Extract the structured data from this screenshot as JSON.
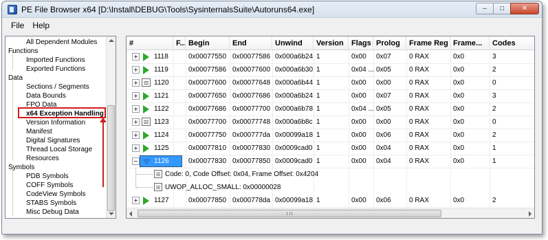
{
  "window": {
    "title": "PE File Browser x64 [D:\\Install\\DEBUG\\Tools\\SysinternalsSuite\\Autoruns64.exe]",
    "min_glyph": "–",
    "max_glyph": "□",
    "close_glyph": "✕"
  },
  "menu": [
    {
      "label": "File"
    },
    {
      "label": "Help"
    }
  ],
  "tree": {
    "items": [
      {
        "label": "All Dependent Modules",
        "level": 1
      },
      {
        "label": "Functions",
        "level": 0
      },
      {
        "label": "Imported Functions",
        "level": 1
      },
      {
        "label": "Exported Functions",
        "level": 1
      },
      {
        "label": "Data",
        "level": 0
      },
      {
        "label": "Sections / Segments",
        "level": 1
      },
      {
        "label": "Data Bounds",
        "level": 1
      },
      {
        "label": "FPO Data",
        "level": 1
      },
      {
        "label": "x64 Exception Handling",
        "level": 1,
        "selected": true
      },
      {
        "label": "Version Information",
        "level": 1
      },
      {
        "label": "Manifest",
        "level": 1
      },
      {
        "label": "Digital Signatures",
        "level": 1
      },
      {
        "label": "Thread Local Storage",
        "level": 1
      },
      {
        "label": "Resources",
        "level": 1
      },
      {
        "label": "Symbols",
        "level": 0
      },
      {
        "label": "PDB Symbols",
        "level": 1
      },
      {
        "label": "COFF Symbols",
        "level": 1
      },
      {
        "label": "CodeView Symbols",
        "level": 1
      },
      {
        "label": "STABS Symbols",
        "level": 1
      },
      {
        "label": "Misc Debug Data",
        "level": 1
      }
    ],
    "highlight_color": "#d11a1a"
  },
  "grid": {
    "columns": [
      "#",
      "F...",
      "Begin",
      "End",
      "Unwind",
      "Version",
      "Flags",
      "Prolog",
      "Frame Reg",
      "Frame...",
      "Codes"
    ],
    "rows": [
      {
        "id": "1118",
        "icon": "play-icon",
        "begin": "0x00077550",
        "end": "0x00077586",
        "unwind": "0x000a6b24",
        "version": "1",
        "flags": "0x00",
        "prolog": "0x07",
        "frame_reg": "0 RAX",
        "frame_off": "0x0",
        "codes": "3"
      },
      {
        "id": "1119",
        "icon": "play-icon",
        "begin": "0x00077586",
        "end": "0x00077600",
        "unwind": "0x000a6b30",
        "version": "1",
        "flags": "0x04 ...",
        "prolog": "0x05",
        "frame_reg": "0 RAX",
        "frame_off": "0x0",
        "codes": "2"
      },
      {
        "id": "1120",
        "icon": "doc-icon",
        "begin": "0x00077600",
        "end": "0x00077648",
        "unwind": "0x000a6b44",
        "version": "1",
        "flags": "0x00",
        "prolog": "0x00",
        "frame_reg": "0 RAX",
        "frame_off": "0x0",
        "codes": "0"
      },
      {
        "id": "1121",
        "icon": "play-icon",
        "begin": "0x00077650",
        "end": "0x00077686",
        "unwind": "0x000a6b24",
        "version": "1",
        "flags": "0x00",
        "prolog": "0x07",
        "frame_reg": "0 RAX",
        "frame_off": "0x0",
        "codes": "3"
      },
      {
        "id": "1122",
        "icon": "play-icon",
        "begin": "0x00077686",
        "end": "0x00077700",
        "unwind": "0x000a6b78",
        "version": "1",
        "flags": "0x04 ...",
        "prolog": "0x05",
        "frame_reg": "0 RAX",
        "frame_off": "0x0",
        "codes": "2"
      },
      {
        "id": "1123",
        "icon": "doc-icon",
        "begin": "0x00077700",
        "end": "0x00077748",
        "unwind": "0x000a6b8c",
        "version": "1",
        "flags": "0x00",
        "prolog": "0x00",
        "frame_reg": "0 RAX",
        "frame_off": "0x0",
        "codes": "0"
      },
      {
        "id": "1124",
        "icon": "play-icon",
        "begin": "0x00077750",
        "end": "0x000777da",
        "unwind": "0x00099a18",
        "version": "1",
        "flags": "0x00",
        "prolog": "0x06",
        "frame_reg": "0 RAX",
        "frame_off": "0x0",
        "codes": "2"
      },
      {
        "id": "1125",
        "icon": "play-icon",
        "begin": "0x00077810",
        "end": "0x00077830",
        "unwind": "0x0009cad0",
        "version": "1",
        "flags": "0x00",
        "prolog": "0x04",
        "frame_reg": "0 RAX",
        "frame_off": "0x0",
        "codes": "1"
      },
      {
        "id": "1126",
        "icon": "tri-down-icon",
        "expanded": true,
        "selected": true,
        "begin": "0x00077830",
        "end": "0x00077850",
        "unwind": "0x0009cad0",
        "version": "1",
        "flags": "0x00",
        "prolog": "0x04",
        "frame_reg": "0 RAX",
        "frame_off": "0x0",
        "codes": "1"
      },
      {
        "id": "1127",
        "icon": "play-icon",
        "begin": "0x00077850",
        "end": "0x000778da",
        "unwind": "0x00099a18",
        "version": "1",
        "flags": "0x00",
        "prolog": "0x06",
        "frame_reg": "0 RAX",
        "frame_off": "0x0",
        "codes": "2"
      }
    ],
    "children_1126": [
      {
        "text": "Code: 0, Code Offset: 0x04, Frame Offset: 0x4204"
      },
      {
        "text": "UWOP_ALLOC_SMALL: 0x00000028"
      }
    ],
    "selection_color": "#3399ff",
    "play_icon_color": "#2ea82e",
    "expand_icon_color": "#2f7fd6"
  }
}
